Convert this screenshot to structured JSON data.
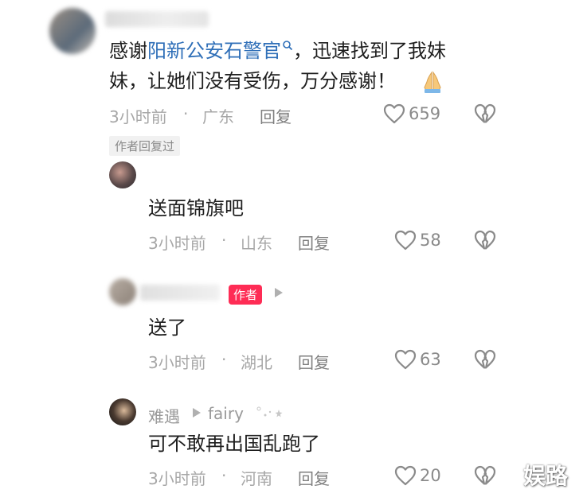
{
  "comments": [
    {
      "text_prefix": "感谢",
      "link_text": "阳新公安石警官",
      "text_line1_suffix": "，迅速找到了我妹",
      "text_line2": "妹，让她们没有受伤，万分感谢！",
      "time": "3小时前",
      "location": "广东",
      "reply_label": "回复",
      "likes": "659",
      "author_replied_label": "作者回复过"
    }
  ],
  "replies": [
    {
      "text": "送面锦旗吧",
      "time": "3小时前",
      "location": "山东",
      "reply_label": "回复",
      "likes": "58"
    },
    {
      "author_tag": "作者",
      "text": "送了",
      "time": "3小时前",
      "location": "湖北",
      "reply_label": "回复",
      "likes": "63"
    },
    {
      "username": "难遇",
      "reply_to": "fairy",
      "text": "可不敢再出国乱跑了",
      "time": "3小时前",
      "location": "河南",
      "reply_label": "回复",
      "likes": "20"
    }
  ],
  "separator": "·",
  "watermark": "娱路",
  "icons": {
    "search": "search-icon",
    "praying_hands": "praying-hands-emoji",
    "like": "heart-outline-icon",
    "dislike": "broken-heart-icon",
    "reply_arrow": "triangle-right-icon"
  },
  "colors": {
    "link": "#2f6fb8",
    "author_tag": "#fe2c55",
    "meta": "#a7a7a7"
  }
}
